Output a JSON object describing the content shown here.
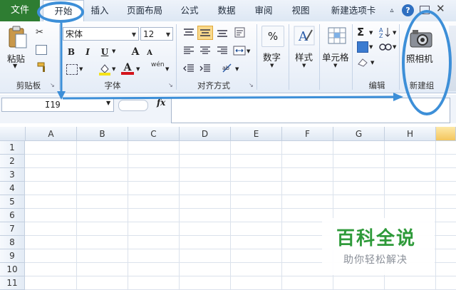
{
  "tabs": {
    "file": "文件",
    "home": "开始",
    "insert": "插入",
    "page_layout": "页面布局",
    "formulas": "公式",
    "data": "数据",
    "review": "审阅",
    "view": "视图",
    "new_tab": "新建选项卡"
  },
  "clipboard": {
    "paste": "粘贴",
    "label": "剪贴板"
  },
  "font": {
    "name": "宋体",
    "size": "12",
    "bold": "B",
    "italic": "I",
    "underline": "U",
    "grow": "A",
    "shrink": "A",
    "color_a": "A",
    "pinyin": "wén",
    "label": "字体"
  },
  "alignment": {
    "label": "对齐方式"
  },
  "number": {
    "symbol": "%",
    "label": "数字"
  },
  "styles": {
    "label": "样式"
  },
  "cells": {
    "label": "单元格"
  },
  "editing": {
    "sum": "Σ",
    "label": "编辑"
  },
  "camera": {
    "button": "照相机",
    "group": "新建组"
  },
  "formula_bar": {
    "cell_ref": "I19",
    "fx": "fx"
  },
  "columns": [
    "A",
    "B",
    "C",
    "D",
    "E",
    "F",
    "G",
    "H"
  ],
  "rows": [
    "1",
    "2",
    "3",
    "4",
    "5",
    "6",
    "7",
    "8",
    "9",
    "10",
    "11"
  ],
  "watermark": {
    "title": "百科全说",
    "subtitle": "助你轻松解决"
  },
  "colors": {
    "file_tab": "#2e7d32",
    "annotation": "#3d8fd8",
    "watermark_green": "#2e9a3a"
  }
}
